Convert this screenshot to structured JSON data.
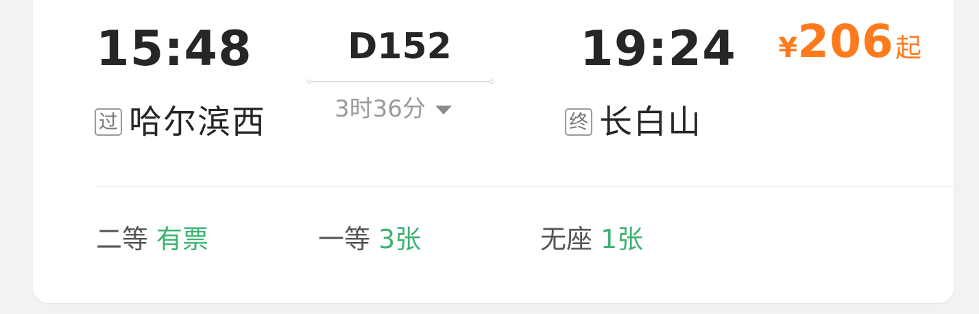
{
  "train": {
    "number": "D152",
    "duration": "3时36分",
    "duration_toggle_icon": "caret-down-icon",
    "departure": {
      "time": "15:48",
      "tag": "过",
      "station": "哈尔滨西"
    },
    "arrival": {
      "time": "19:24",
      "tag": "终",
      "station": "长白山"
    },
    "price": {
      "symbol": "¥",
      "amount": "206",
      "suffix": "起"
    }
  },
  "seats": [
    {
      "class": "二等",
      "availability": "有票"
    },
    {
      "class": "一等",
      "availability": "3张"
    },
    {
      "class": "无座",
      "availability": "1张"
    }
  ],
  "colors": {
    "price": "#ff7a1c",
    "availability": "#3cb371",
    "primary_text": "#262626",
    "secondary_text": "#9a9a9a"
  }
}
